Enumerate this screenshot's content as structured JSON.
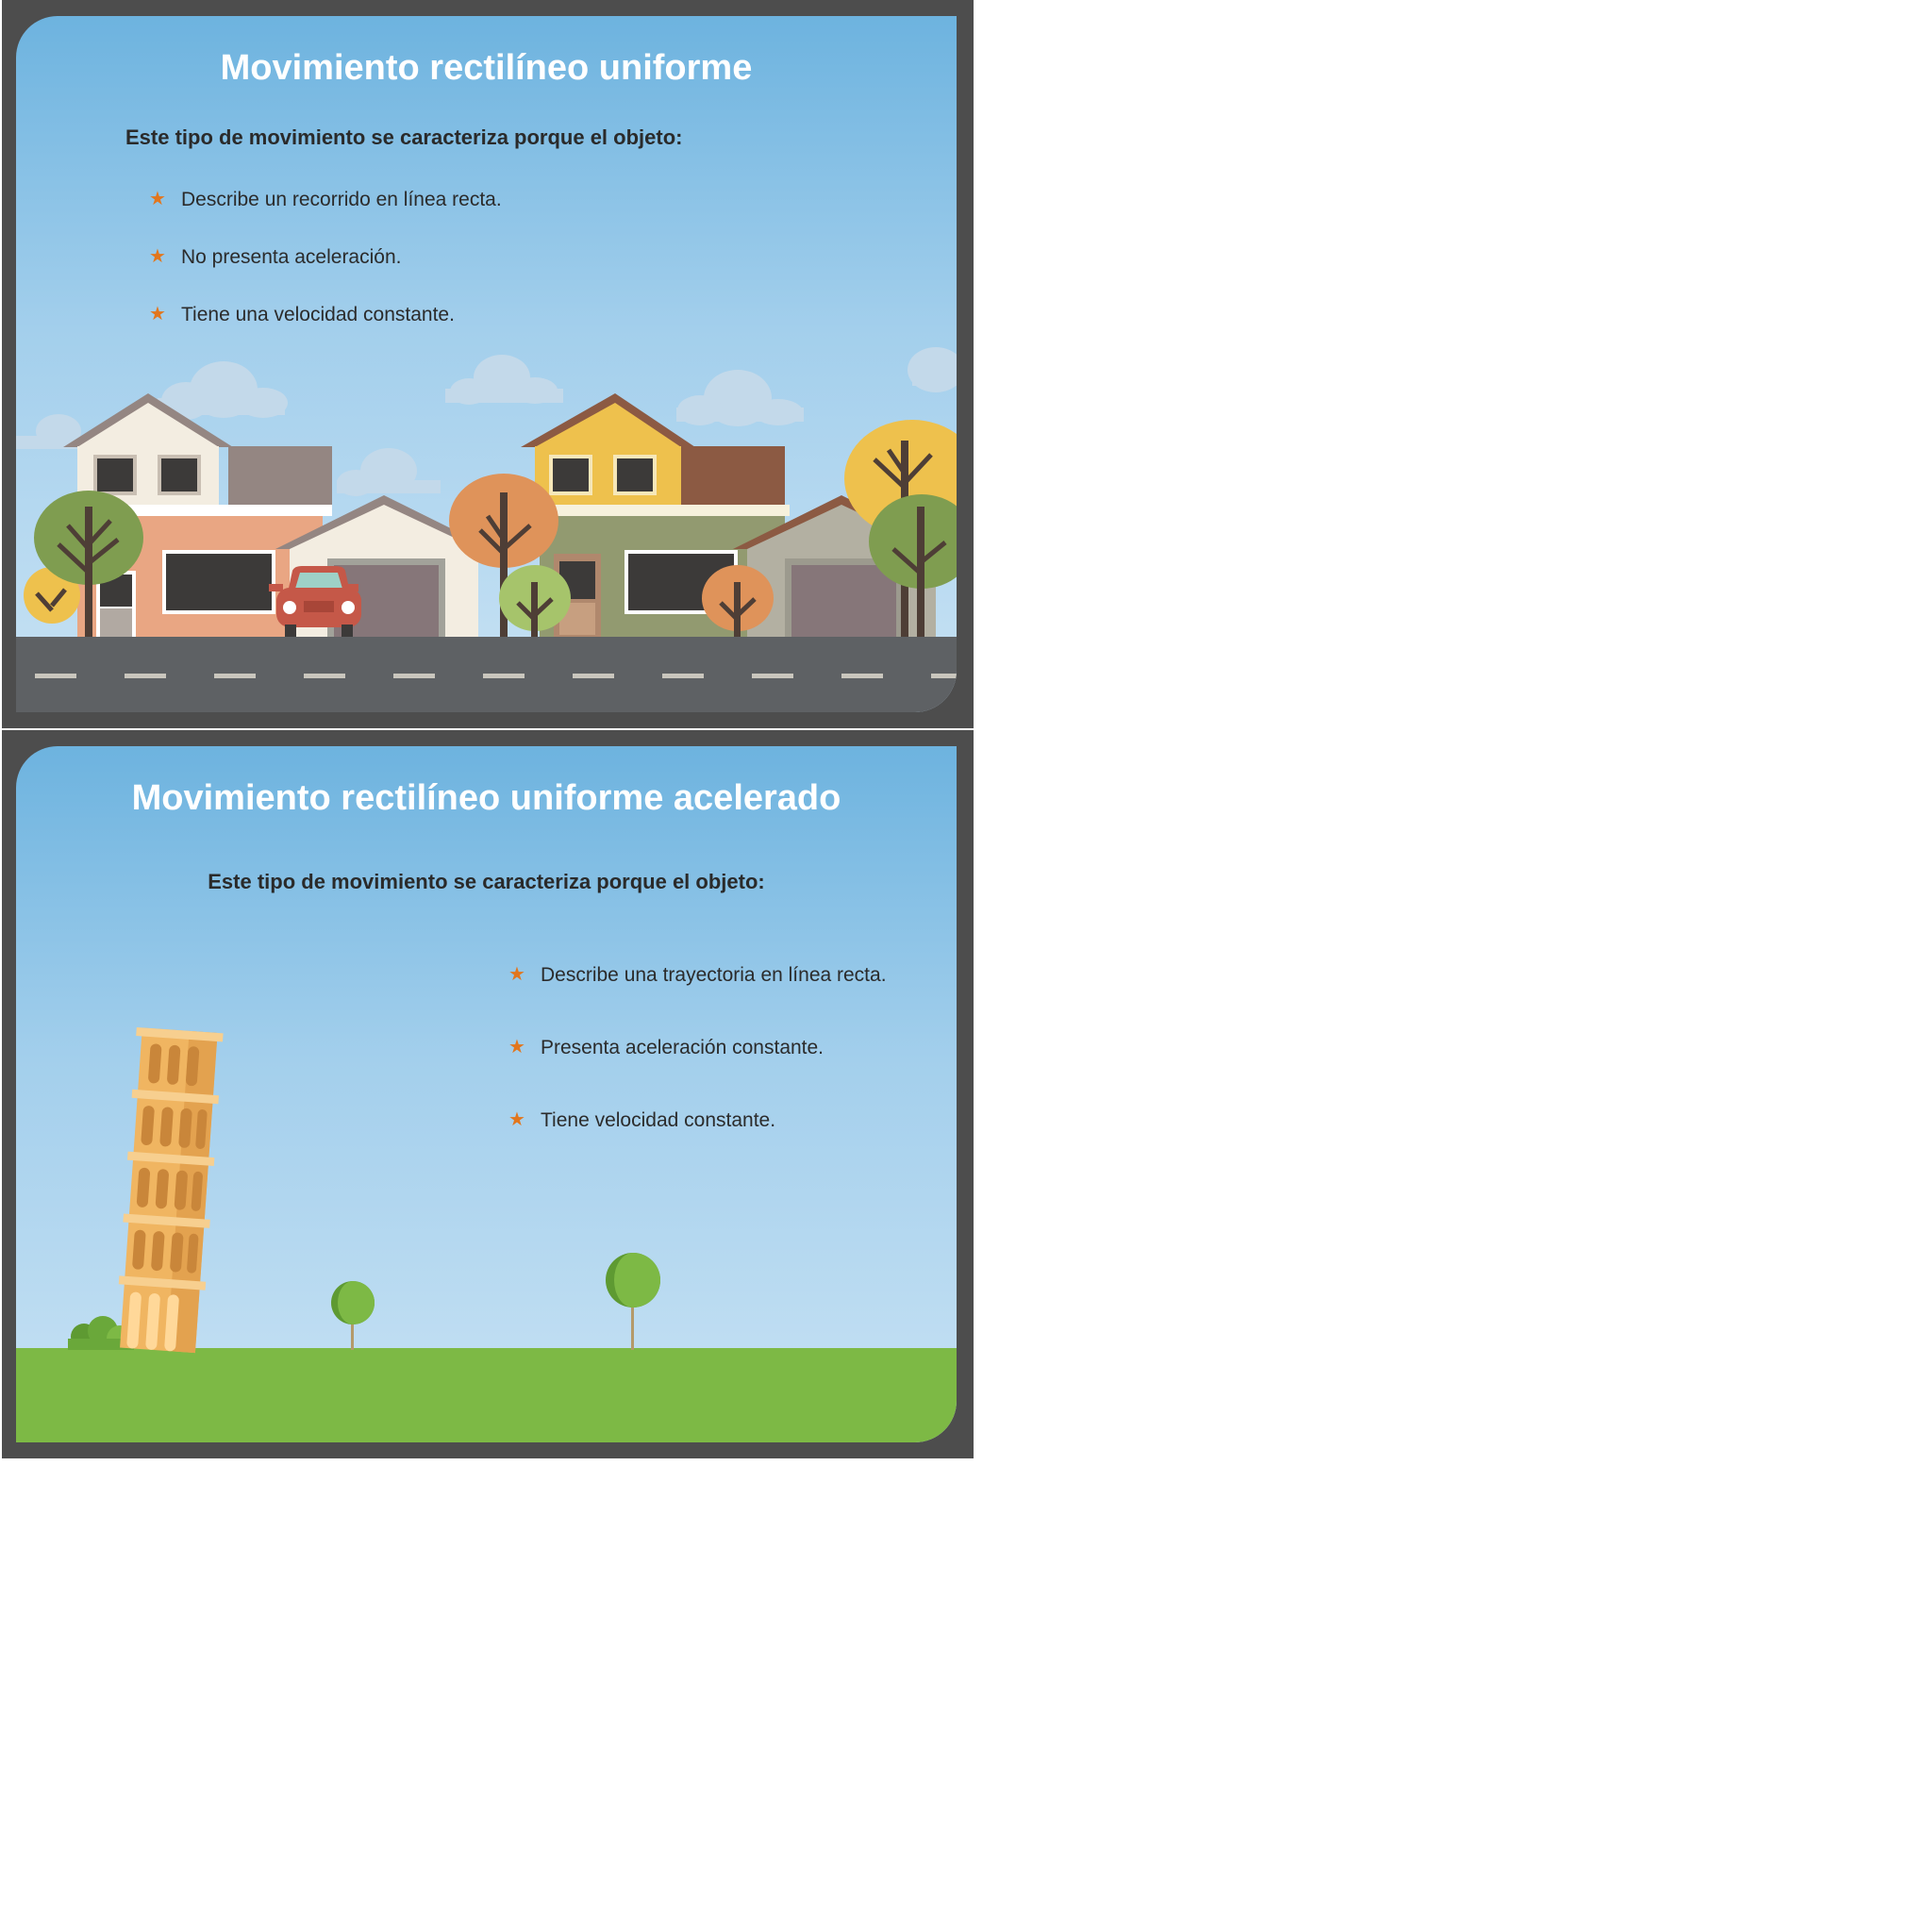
{
  "slides": [
    {
      "title": "Movimiento rectilíneo uniforme",
      "subtitle": "Este tipo de movimiento se caracteriza porque el objeto:",
      "bullets": [
        "Describe un recorrido en línea recta.",
        "No presenta aceleración.",
        "Tiene una velocidad constante."
      ],
      "bullet_icon": "star-icon"
    },
    {
      "title": "Movimiento rectilíneo uniforme acelerado",
      "subtitle": "Este tipo de movimiento se caracteriza porque el objeto:",
      "bullets": [
        "Describe una trayectoria en línea recta.",
        "Presenta aceleración constante.",
        "Tiene velocidad constante."
      ],
      "bullet_icon": "star-icon"
    }
  ],
  "colors": {
    "frame": "#4d4d4d",
    "sky_top": "#6db3df",
    "sky_bottom": "#c8e2f4",
    "bullet_star": "#e2761d",
    "road": "#5e6164",
    "grass": "#7db945"
  }
}
